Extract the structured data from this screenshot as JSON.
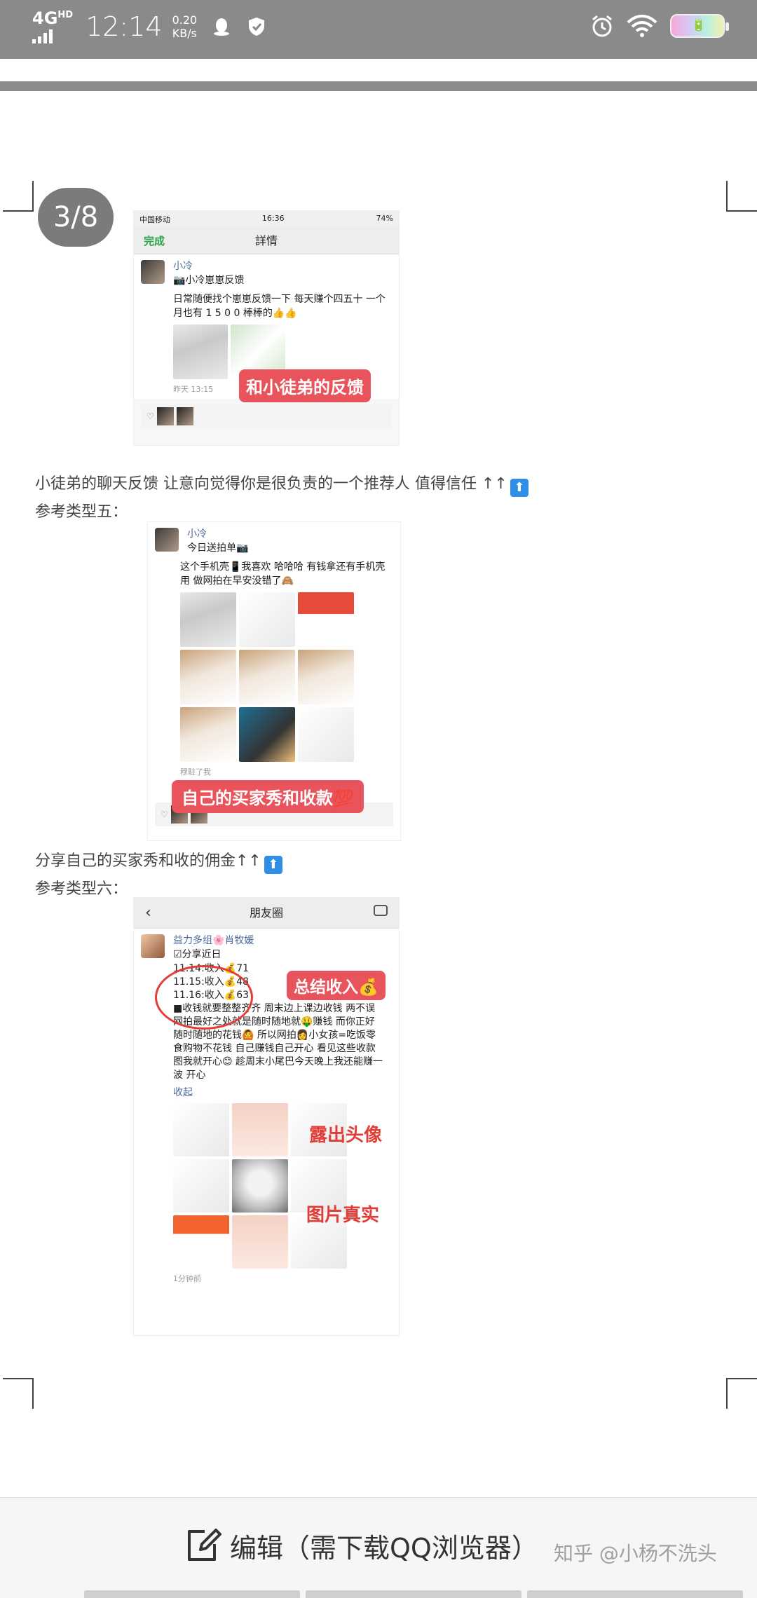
{
  "status_bar": {
    "network": "4G",
    "network_sup": "HD",
    "time": "12:14",
    "speed_value": "0.20",
    "speed_unit": "KB/s",
    "battery_level": "low"
  },
  "pager": {
    "label": "3/8"
  },
  "shot1": {
    "carrier": "中国移动",
    "time": "16:36",
    "battery": "74%",
    "done": "完成",
    "title": "詳情",
    "name": "小冷",
    "subtitle": "📷小冷崽崽反馈",
    "body": "日常随便找个崽崽反馈一下 每天赚个四五十 一个月也有 1 5 0 0 棒棒的👍👍",
    "time_meta": "昨天 13:15",
    "tag": "和小徒弟的反馈"
  },
  "para1": "小徒弟的聊天反馈  让意向觉得你是很负责的一个推荐人  值得信任  ↑↑",
  "para2": "参考类型五：",
  "shot2": {
    "name": "小冷",
    "subtitle": "今日送拍单📷",
    "body": "这个手机壳📱我喜欢 哈哈哈 有钱拿还有手机壳用 做网拍在早安没错了🙈",
    "meta": "穆駐了我",
    "tag": "自己的买家秀和收款💯"
  },
  "para3": "分享自己的买家秀和收的佣金↑↑",
  "para4": "参考类型六：",
  "shot3": {
    "title": "朋友圈",
    "name": "益力多组🌸肖牧媛",
    "subtitle": "☑分享近日",
    "line1": "11.14:收入💰71",
    "line2": "11.15:收入💰48",
    "line3": "11.16:收入💰63",
    "body": "■收钱就要整整齐齐 周末边上课边收钱 两不误 网拍最好之处就是随时随地就🤑赚钱 而你正好随时随地的花钱🙆 所以网拍👩小女孩=吃饭零食购物不花钱 自己赚钱自己开心 看见这些收款图我就开心😊 趁周末小尾巴今天晚上我还能赚一波 开心",
    "collapse": "收起",
    "meta": "1分钟前",
    "tag": "总结收入💰",
    "note1": "露出头像",
    "note2": "图片真实"
  },
  "bottom_bar": {
    "edit_label": "编辑（需下载QQ浏览器）",
    "watermark": "知乎 @小杨不洗头"
  },
  "colors": {
    "status_bar": "#8a8a8a",
    "tag_red": "#e8535c",
    "link_blue": "#4b6a9b",
    "arrow_blue": "#2f8fe5"
  }
}
